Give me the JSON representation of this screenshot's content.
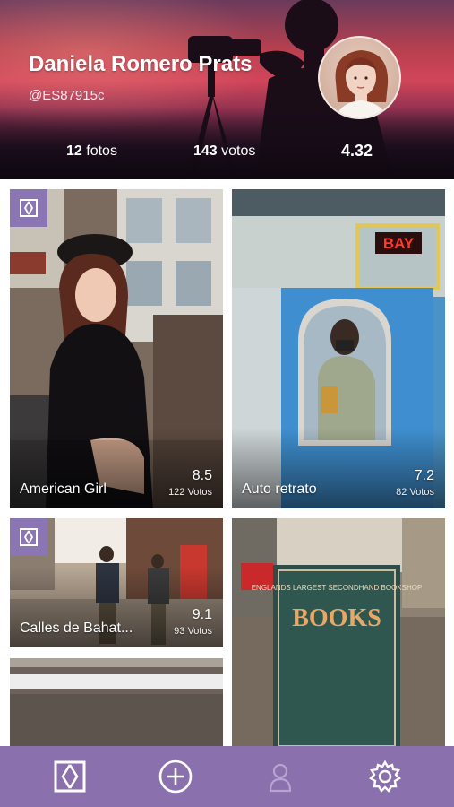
{
  "profile": {
    "name": "Daniela Romero Prats",
    "handle": "@ES87915c",
    "photos_count": "12",
    "photos_label": "fotos",
    "votes_count": "143",
    "votes_label": "votos",
    "rating": "4.32"
  },
  "photos": [
    {
      "title": "American Girl",
      "score": "8.5",
      "votes": "122 Votos",
      "badge": true
    },
    {
      "title": "Auto retrato",
      "score": "7.2",
      "votes": "82 Votos",
      "badge": false
    },
    {
      "title": "Calles de Bahat...",
      "score": "9.1",
      "votes": "93 Votos",
      "badge": true
    },
    {
      "title": "",
      "score": "",
      "votes": "",
      "badge": false
    },
    {
      "title": "",
      "score": "",
      "votes": "",
      "badge": false
    }
  ],
  "photo_signs": {
    "bay_sign": "BAY",
    "bookshop_top": "ENGLANDS LARGEST SECONDHAND BOOKSHOP",
    "bookshop_big": "BOOKS"
  },
  "nav": {
    "items": [
      {
        "icon": "home-logo-icon",
        "active": true
      },
      {
        "icon": "add-circle-icon",
        "active": true
      },
      {
        "icon": "profile-icon",
        "active": false
      },
      {
        "icon": "gear-icon",
        "active": true
      }
    ]
  },
  "colors": {
    "accent": "#8a70ac",
    "badge": "#8c75b3"
  }
}
